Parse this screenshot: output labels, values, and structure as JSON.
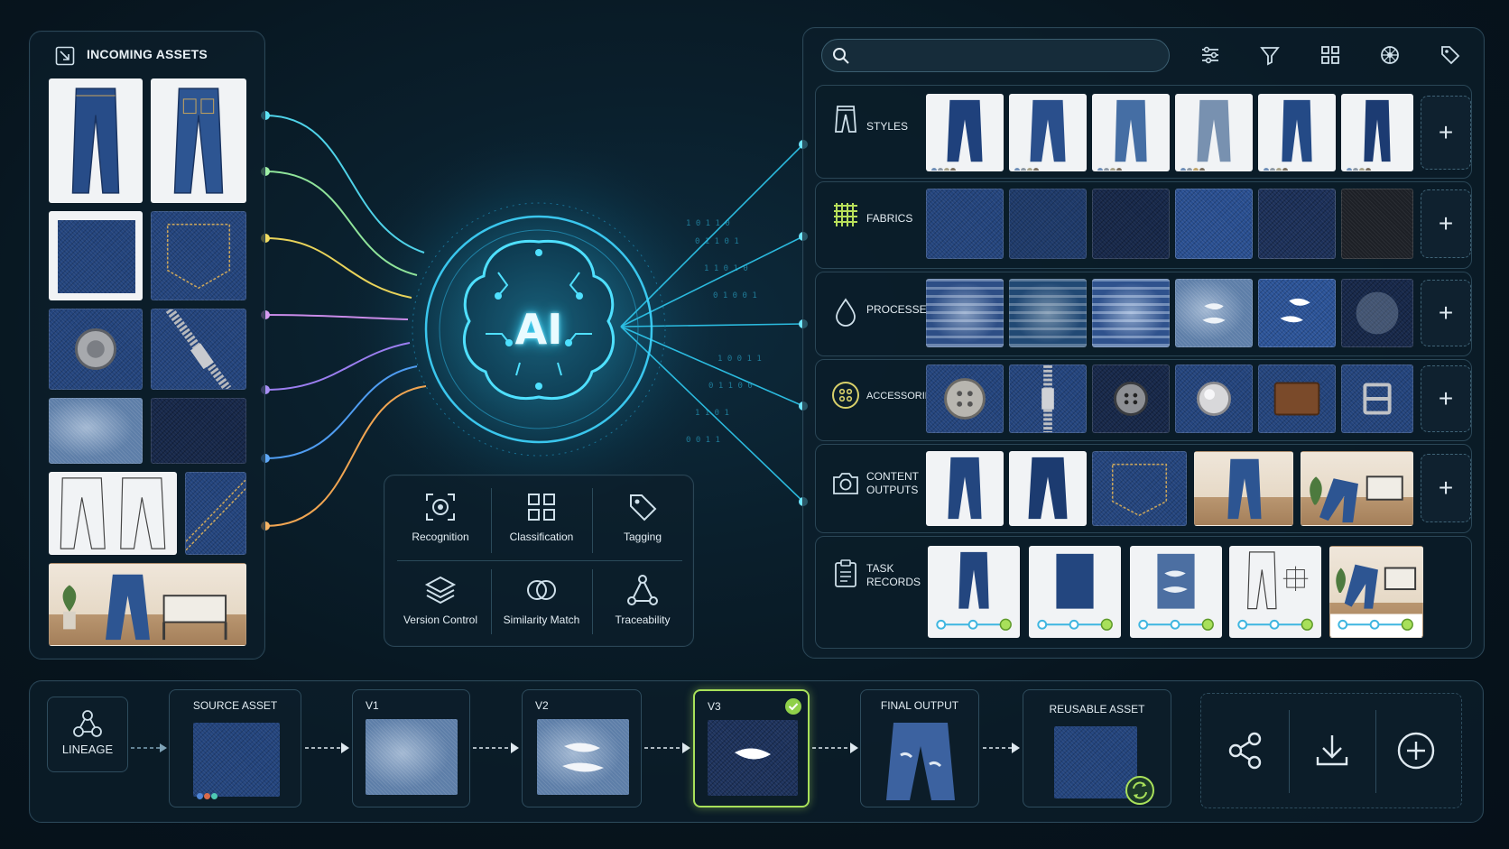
{
  "incoming": {
    "title": "INCOMING ASSETS"
  },
  "ai": {
    "label": "AI"
  },
  "capabilities": [
    {
      "label": "Recognition",
      "icon": "scan-eye-icon"
    },
    {
      "label": "Classification",
      "icon": "grid-icon"
    },
    {
      "label": "Tagging",
      "icon": "tag-icon"
    },
    {
      "label": "Version Control",
      "icon": "layers-icon"
    },
    {
      "label": "Similarity Match",
      "icon": "overlap-circles-icon"
    },
    {
      "label": "Traceability",
      "icon": "node-graph-icon"
    }
  ],
  "search": {
    "value": "",
    "placeholder": ""
  },
  "toolbar": [
    "sliders-icon",
    "filter-icon",
    "grid-view-icon",
    "palette-icon",
    "tag-icon"
  ],
  "library": {
    "rows": [
      {
        "label": "STYLES",
        "icon": "trousers-icon"
      },
      {
        "label": "FABRICS",
        "icon": "weave-icon"
      },
      {
        "label": "PROCESSES",
        "icon": "droplet-icon"
      },
      {
        "label": "ACCESSORIES",
        "icon": "button-icon"
      },
      {
        "label": "CONTENT\nOUTPUTS",
        "icon": "camera-icon"
      },
      {
        "label": "TASK\nRECORDS",
        "icon": "clipboard-icon"
      }
    ],
    "add_label": "+"
  },
  "lineage": {
    "title": "LINEAGE",
    "stages": [
      {
        "label": "SOURCE ASSET"
      },
      {
        "label": "V1"
      },
      {
        "label": "V2"
      },
      {
        "label": "V3",
        "selected": true
      },
      {
        "label": "FINAL OUTPUT"
      },
      {
        "label": "REUSABLE ASSET"
      }
    ],
    "actions": [
      "share-icon",
      "download-icon",
      "add-circle-icon"
    ]
  },
  "colors": {
    "accent": "#3fd6ff",
    "selected": "#a8e05a",
    "panel_border": "#2a4656"
  }
}
